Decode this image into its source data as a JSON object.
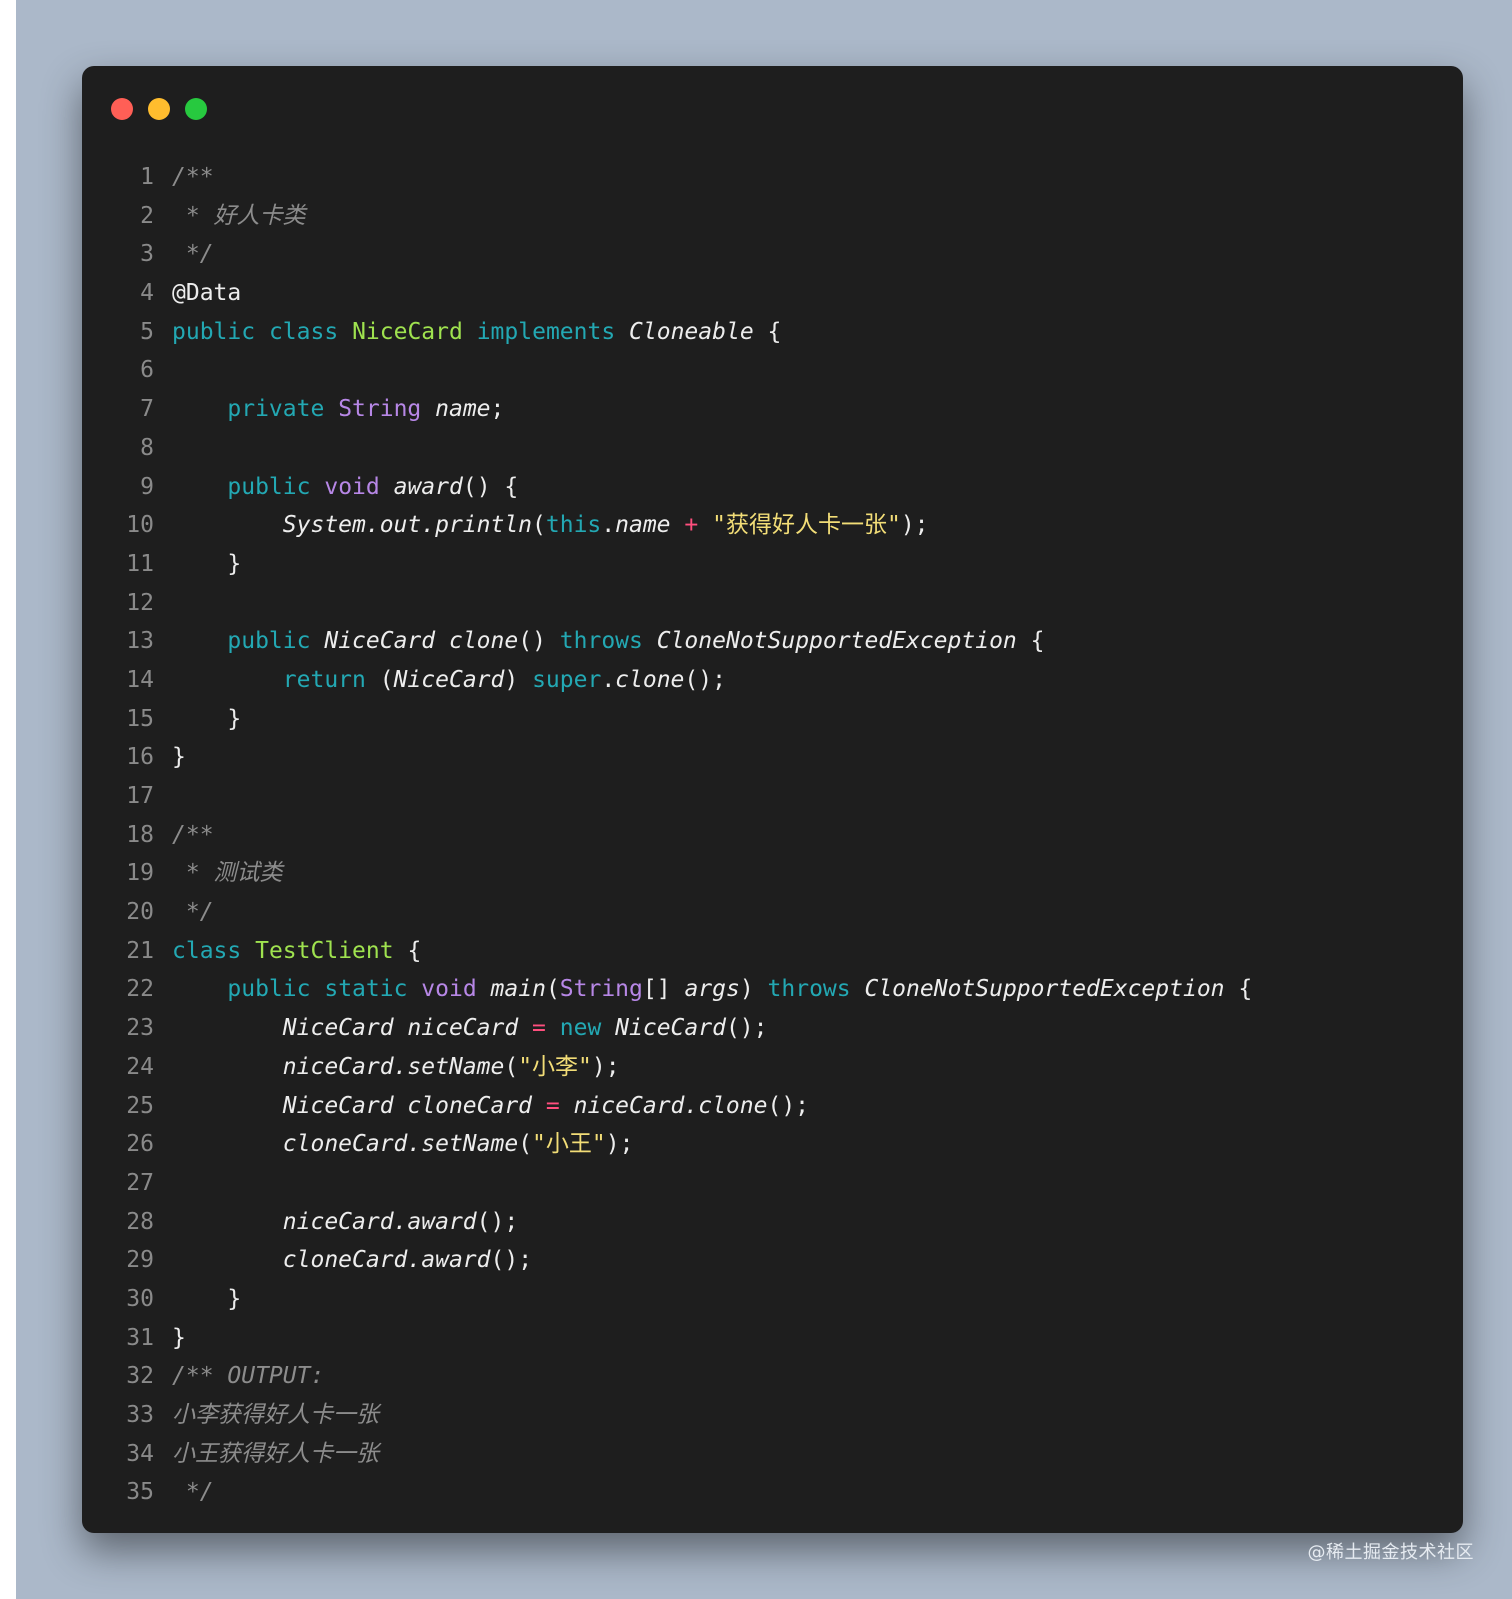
{
  "window": {
    "controls": [
      "close",
      "minimize",
      "maximize"
    ],
    "colors": {
      "background": "#1e1e1e",
      "close": "#ff5f56",
      "minimize": "#ffbd2e",
      "maximize": "#27c93f"
    }
  },
  "code": {
    "language": "java",
    "lines": [
      {
        "n": "1",
        "tokens": [
          {
            "t": "cm",
            "v": "/**"
          }
        ]
      },
      {
        "n": "2",
        "tokens": [
          {
            "t": "cm",
            "v": " * 好人卡类"
          }
        ]
      },
      {
        "n": "3",
        "tokens": [
          {
            "t": "cm",
            "v": " */"
          }
        ]
      },
      {
        "n": "4",
        "tokens": [
          {
            "t": "pl",
            "v": "@Data"
          }
        ]
      },
      {
        "n": "5",
        "tokens": [
          {
            "t": "kw",
            "v": "public"
          },
          {
            "t": "pl",
            "v": " "
          },
          {
            "t": "kw",
            "v": "class"
          },
          {
            "t": "pl",
            "v": " "
          },
          {
            "t": "cls",
            "v": "NiceCard"
          },
          {
            "t": "pl",
            "v": " "
          },
          {
            "t": "kw",
            "v": "implements"
          },
          {
            "t": "pl",
            "v": " "
          },
          {
            "t": "it",
            "v": "Cloneable"
          },
          {
            "t": "pl",
            "v": " {"
          }
        ]
      },
      {
        "n": "6",
        "tokens": []
      },
      {
        "n": "7",
        "tokens": [
          {
            "t": "pl",
            "v": "    "
          },
          {
            "t": "kw",
            "v": "private"
          },
          {
            "t": "pl",
            "v": " "
          },
          {
            "t": "ty",
            "v": "String"
          },
          {
            "t": "pl",
            "v": " "
          },
          {
            "t": "it",
            "v": "name"
          },
          {
            "t": "pl",
            "v": ";"
          }
        ]
      },
      {
        "n": "8",
        "tokens": []
      },
      {
        "n": "9",
        "tokens": [
          {
            "t": "pl",
            "v": "    "
          },
          {
            "t": "kw",
            "v": "public"
          },
          {
            "t": "pl",
            "v": " "
          },
          {
            "t": "ty",
            "v": "void"
          },
          {
            "t": "pl",
            "v": " "
          },
          {
            "t": "it",
            "v": "award"
          },
          {
            "t": "pl",
            "v": "() {"
          }
        ]
      },
      {
        "n": "10",
        "tokens": [
          {
            "t": "pl",
            "v": "        "
          },
          {
            "t": "it",
            "v": "System.out.println"
          },
          {
            "t": "pl",
            "v": "("
          },
          {
            "t": "kw",
            "v": "this"
          },
          {
            "t": "pl",
            "v": "."
          },
          {
            "t": "it",
            "v": "name"
          },
          {
            "t": "pl",
            "v": " "
          },
          {
            "t": "op",
            "v": "+"
          },
          {
            "t": "pl",
            "v": " "
          },
          {
            "t": "str",
            "v": "\"获得好人卡一张\""
          },
          {
            "t": "pl",
            "v": ");"
          }
        ]
      },
      {
        "n": "11",
        "tokens": [
          {
            "t": "pl",
            "v": "    }"
          }
        ]
      },
      {
        "n": "12",
        "tokens": []
      },
      {
        "n": "13",
        "tokens": [
          {
            "t": "pl",
            "v": "    "
          },
          {
            "t": "kw",
            "v": "public"
          },
          {
            "t": "pl",
            "v": " "
          },
          {
            "t": "it",
            "v": "NiceCard"
          },
          {
            "t": "pl",
            "v": " "
          },
          {
            "t": "it",
            "v": "clone"
          },
          {
            "t": "pl",
            "v": "() "
          },
          {
            "t": "kw",
            "v": "throws"
          },
          {
            "t": "pl",
            "v": " "
          },
          {
            "t": "it",
            "v": "CloneNotSupportedException"
          },
          {
            "t": "pl",
            "v": " {"
          }
        ]
      },
      {
        "n": "14",
        "tokens": [
          {
            "t": "pl",
            "v": "        "
          },
          {
            "t": "kw",
            "v": "return"
          },
          {
            "t": "pl",
            "v": " ("
          },
          {
            "t": "it",
            "v": "NiceCard"
          },
          {
            "t": "pl",
            "v": ") "
          },
          {
            "t": "kw",
            "v": "super"
          },
          {
            "t": "pl",
            "v": "."
          },
          {
            "t": "it",
            "v": "clone"
          },
          {
            "t": "pl",
            "v": "();"
          }
        ]
      },
      {
        "n": "15",
        "tokens": [
          {
            "t": "pl",
            "v": "    }"
          }
        ]
      },
      {
        "n": "16",
        "tokens": [
          {
            "t": "pl",
            "v": "}"
          }
        ]
      },
      {
        "n": "17",
        "tokens": []
      },
      {
        "n": "18",
        "tokens": [
          {
            "t": "cm",
            "v": "/**"
          }
        ]
      },
      {
        "n": "19",
        "tokens": [
          {
            "t": "cm",
            "v": " * 测试类"
          }
        ]
      },
      {
        "n": "20",
        "tokens": [
          {
            "t": "cm",
            "v": " */"
          }
        ]
      },
      {
        "n": "21",
        "tokens": [
          {
            "t": "kw",
            "v": "class"
          },
          {
            "t": "pl",
            "v": " "
          },
          {
            "t": "cls",
            "v": "TestClient"
          },
          {
            "t": "pl",
            "v": " {"
          }
        ]
      },
      {
        "n": "22",
        "tokens": [
          {
            "t": "pl",
            "v": "    "
          },
          {
            "t": "kw",
            "v": "public"
          },
          {
            "t": "pl",
            "v": " "
          },
          {
            "t": "kw",
            "v": "static"
          },
          {
            "t": "pl",
            "v": " "
          },
          {
            "t": "ty",
            "v": "void"
          },
          {
            "t": "pl",
            "v": " "
          },
          {
            "t": "it",
            "v": "main"
          },
          {
            "t": "pl",
            "v": "("
          },
          {
            "t": "ty",
            "v": "String"
          },
          {
            "t": "pl",
            "v": "[] "
          },
          {
            "t": "it",
            "v": "args"
          },
          {
            "t": "pl",
            "v": ") "
          },
          {
            "t": "kw",
            "v": "throws"
          },
          {
            "t": "pl",
            "v": " "
          },
          {
            "t": "it",
            "v": "CloneNotSupportedException"
          },
          {
            "t": "pl",
            "v": " {"
          }
        ]
      },
      {
        "n": "23",
        "tokens": [
          {
            "t": "pl",
            "v": "        "
          },
          {
            "t": "it",
            "v": "NiceCard niceCard"
          },
          {
            "t": "pl",
            "v": " "
          },
          {
            "t": "op",
            "v": "="
          },
          {
            "t": "pl",
            "v": " "
          },
          {
            "t": "kw",
            "v": "new"
          },
          {
            "t": "pl",
            "v": " "
          },
          {
            "t": "it",
            "v": "NiceCard"
          },
          {
            "t": "pl",
            "v": "();"
          }
        ]
      },
      {
        "n": "24",
        "tokens": [
          {
            "t": "pl",
            "v": "        "
          },
          {
            "t": "it",
            "v": "niceCard.setName"
          },
          {
            "t": "pl",
            "v": "("
          },
          {
            "t": "str",
            "v": "\"小李\""
          },
          {
            "t": "pl",
            "v": ");"
          }
        ]
      },
      {
        "n": "25",
        "tokens": [
          {
            "t": "pl",
            "v": "        "
          },
          {
            "t": "it",
            "v": "NiceCard cloneCard"
          },
          {
            "t": "pl",
            "v": " "
          },
          {
            "t": "op",
            "v": "="
          },
          {
            "t": "pl",
            "v": " "
          },
          {
            "t": "it",
            "v": "niceCard.clone"
          },
          {
            "t": "pl",
            "v": "();"
          }
        ]
      },
      {
        "n": "26",
        "tokens": [
          {
            "t": "pl",
            "v": "        "
          },
          {
            "t": "it",
            "v": "cloneCard.setName"
          },
          {
            "t": "pl",
            "v": "("
          },
          {
            "t": "str",
            "v": "\"小王\""
          },
          {
            "t": "pl",
            "v": ");"
          }
        ]
      },
      {
        "n": "27",
        "tokens": []
      },
      {
        "n": "28",
        "tokens": [
          {
            "t": "pl",
            "v": "        "
          },
          {
            "t": "it",
            "v": "niceCard.award"
          },
          {
            "t": "pl",
            "v": "();"
          }
        ]
      },
      {
        "n": "29",
        "tokens": [
          {
            "t": "pl",
            "v": "        "
          },
          {
            "t": "it",
            "v": "cloneCard.award"
          },
          {
            "t": "pl",
            "v": "();"
          }
        ]
      },
      {
        "n": "30",
        "tokens": [
          {
            "t": "pl",
            "v": "    }"
          }
        ]
      },
      {
        "n": "31",
        "tokens": [
          {
            "t": "pl",
            "v": "}"
          }
        ]
      },
      {
        "n": "32",
        "tokens": [
          {
            "t": "cm",
            "v": "/** OUTPUT:"
          }
        ]
      },
      {
        "n": "33",
        "tokens": [
          {
            "t": "cm",
            "v": "小李获得好人卡一张"
          }
        ]
      },
      {
        "n": "34",
        "tokens": [
          {
            "t": "cm",
            "v": "小王获得好人卡一张"
          }
        ]
      },
      {
        "n": "35",
        "tokens": [
          {
            "t": "cm",
            "v": " */"
          }
        ]
      }
    ]
  },
  "watermark": "@稀土掘金技术社区",
  "theme": {
    "backdrop": "#abb8c9",
    "keyword": "#23a8b3",
    "type": "#b787e6",
    "class_name": "#9fe24f",
    "string": "#f2dd77",
    "operator": "#ff4f7e",
    "comment": "#8c8c8c"
  }
}
